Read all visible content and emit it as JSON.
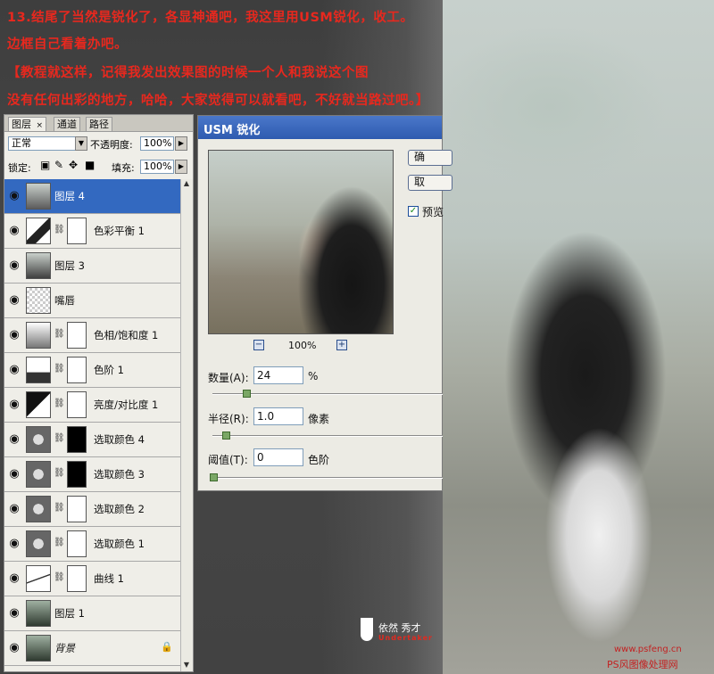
{
  "header": {
    "line1": "13.结尾了当然是锐化了，各显神通吧，我这里用USM锐化，收工。",
    "line2": "边框自己看着办吧。",
    "line3": "【教程就这样，记得我发出效果图的时候一个人和我说这个图",
    "line4": "没有任何出彩的地方，哈哈，大家觉得可以就看吧，不好就当路过吧。】"
  },
  "layers_panel": {
    "tabs": [
      "图层",
      "通道",
      "路径"
    ],
    "tab_close": "×",
    "blend_mode": "正常",
    "opacity_label": "不透明度:",
    "opacity_value": "100%",
    "lock_label": "锁定:",
    "fill_label": "填充:",
    "fill_value": "100%"
  },
  "layers": [
    {
      "name": "图层 4"
    },
    {
      "name": "色彩平衡 1"
    },
    {
      "name": "图层 3"
    },
    {
      "name": "嘴唇"
    },
    {
      "name": "色相/饱和度 1"
    },
    {
      "name": "色阶 1"
    },
    {
      "name": "亮度/对比度 1"
    },
    {
      "name": "选取颜色 4"
    },
    {
      "name": "选取颜色 3"
    },
    {
      "name": "选取颜色 2"
    },
    {
      "name": "选取颜色 1"
    },
    {
      "name": "曲线 1"
    },
    {
      "name": "图层 1"
    },
    {
      "name": "背景"
    }
  ],
  "dialog": {
    "title": "USM 锐化",
    "ok_label": "确",
    "cancel_label": "取",
    "preview_label": "预览",
    "zoom": "100%",
    "amount": {
      "label": "数量(A):",
      "value": "24",
      "unit": "%"
    },
    "radius": {
      "label": "半径(R):",
      "value": "1.0",
      "unit": "像素"
    },
    "threshold": {
      "label": "阈值(T):",
      "value": "0",
      "unit": "色阶"
    }
  },
  "watermark": {
    "name": "依然  秀才",
    "sub": "Undertaker",
    "url": "www.psfeng.cn",
    "site_name": "PS风图像处理网"
  },
  "colors": {
    "instruction_text": "#e8281e",
    "selection": "#3369c0",
    "title_bar": "#2e5bb0"
  }
}
